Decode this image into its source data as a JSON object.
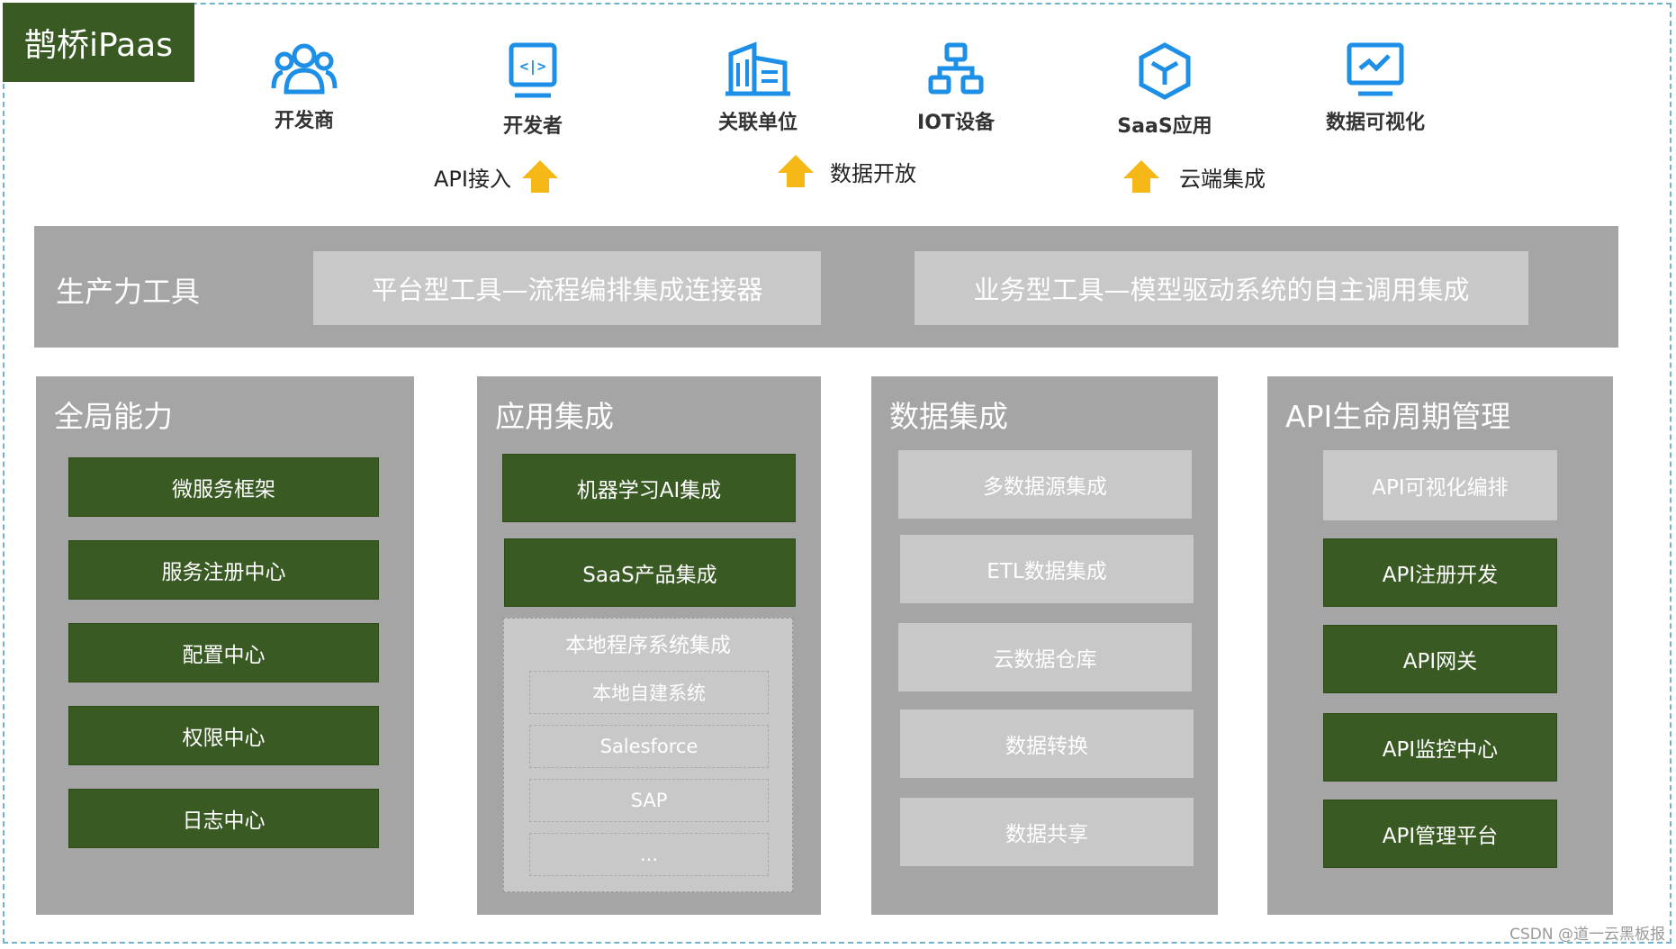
{
  "brand": "鹊桥iPaas",
  "icons": [
    {
      "name": "developer-org-icon",
      "label": "开发商"
    },
    {
      "name": "developer-icon",
      "label": "开发者"
    },
    {
      "name": "building-icon",
      "label": "关联单位"
    },
    {
      "name": "network-icon",
      "label": "IOT设备"
    },
    {
      "name": "cube-icon",
      "label": "SaaS应用"
    },
    {
      "name": "chart-monitor-icon",
      "label": "数据可视化"
    }
  ],
  "flows": [
    "API接入",
    "数据开放",
    "云端集成"
  ],
  "productivity": {
    "title": "生产力工具",
    "platform": "平台型工具—流程编排集成连接器",
    "business": "业务型工具—模型驱动系统的自主调用集成"
  },
  "global": {
    "title": "全局能力",
    "items": [
      "微服务框架",
      "服务注册中心",
      "配置中心",
      "权限中心",
      "日志中心"
    ]
  },
  "app": {
    "title": "应用集成",
    "items": [
      "机器学习AI集成",
      "SaaS产品集成"
    ],
    "local_title": "本地程序系统集成",
    "local_items": [
      "本地自建系统",
      "Salesforce",
      "SAP",
      "..."
    ]
  },
  "data": {
    "title": "数据集成",
    "items": [
      "多数据源集成",
      "ETL数据集成",
      "云数据仓库",
      "数据转换",
      "数据共享"
    ]
  },
  "api": {
    "title": "API生命周期管理",
    "items": [
      "API可视化编排",
      "API注册开发",
      "API网关",
      "API监控中心",
      "API管理平台"
    ]
  },
  "watermark": "CSDN @道一云黑板报",
  "colors": {
    "green": "#3a5a23",
    "gray": "#a5a5a5",
    "light": "#c8c8c8",
    "icon_blue": "#1d8fe6",
    "arrow": "#f6b817"
  }
}
